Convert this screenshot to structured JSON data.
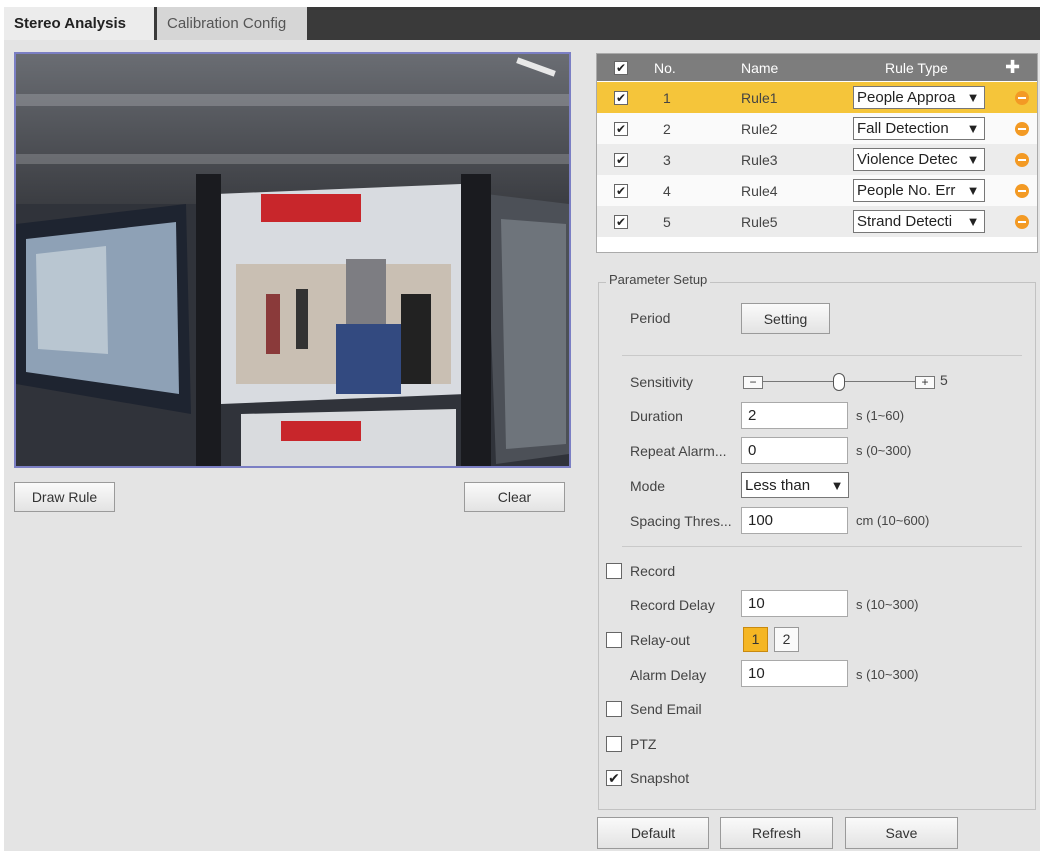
{
  "tabs": [
    {
      "label": "Stereo Analysis",
      "active": true
    },
    {
      "label": "Calibration Config",
      "active": false
    }
  ],
  "video_buttons": {
    "draw_rule": "Draw Rule",
    "clear": "Clear"
  },
  "rule_table": {
    "headers": {
      "no": "No.",
      "name": "Name",
      "rule_type": "Rule Type"
    },
    "header_checked": true,
    "rows": [
      {
        "no": "1",
        "name": "Rule1",
        "type": "People Approa",
        "checked": true,
        "selected": true
      },
      {
        "no": "2",
        "name": "Rule2",
        "type": "Fall Detection",
        "checked": true,
        "selected": false
      },
      {
        "no": "3",
        "name": "Rule3",
        "type": "Violence Detec",
        "checked": true,
        "selected": false
      },
      {
        "no": "4",
        "name": "Rule4",
        "type": "People No. Err",
        "checked": true,
        "selected": false
      },
      {
        "no": "5",
        "name": "Rule5",
        "type": "Strand Detecti",
        "checked": true,
        "selected": false
      }
    ]
  },
  "params": {
    "legend": "Parameter Setup",
    "period_label": "Period",
    "period_button": "Setting",
    "sensitivity_label": "Sensitivity",
    "sensitivity_value": "5",
    "sensitivity_level": 0.5,
    "duration_label": "Duration",
    "duration_value": "2",
    "duration_unit": "s (1~60)",
    "repeat_label": "Repeat Alarm...",
    "repeat_value": "0",
    "repeat_unit": "s (0~300)",
    "mode_label": "Mode",
    "mode_value": "Less than",
    "spacing_label": "Spacing Thres...",
    "spacing_value": "100",
    "spacing_unit": "cm (10~600)",
    "record_label": "Record",
    "record_checked": false,
    "record_delay_label": "Record Delay",
    "record_delay_value": "10",
    "record_delay_unit": "s (10~300)",
    "relay_label": "Relay-out",
    "relay_checked": false,
    "relay_options": [
      "1",
      "2"
    ],
    "alarm_delay_label": "Alarm Delay",
    "alarm_delay_value": "10",
    "alarm_delay_unit": "s (10~300)",
    "email_label": "Send Email",
    "email_checked": false,
    "ptz_label": "PTZ",
    "ptz_checked": false,
    "snapshot_label": "Snapshot",
    "snapshot_checked": true
  },
  "footer": {
    "default": "Default",
    "refresh": "Refresh",
    "save": "Save"
  },
  "colors": {
    "accent_selected_row": "#f5c53a",
    "delete_icon": "#f39a24",
    "relay_active": "#f5b623",
    "video_border": "#7b7fc4"
  }
}
